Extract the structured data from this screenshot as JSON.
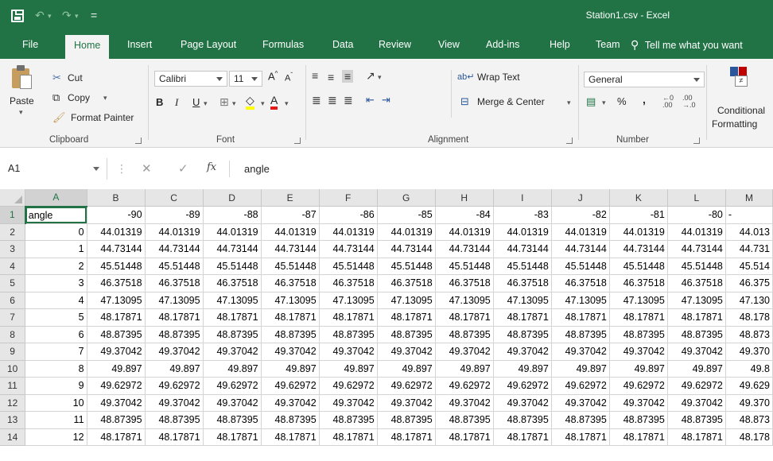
{
  "window": {
    "title": "Station1.csv  -  Excel"
  },
  "qat": {
    "undo": "↶",
    "undo_arrow": "▾",
    "redo": "↷",
    "redo_arrow": "▾",
    "customize": "="
  },
  "tabs": [
    "File",
    "Home",
    "Insert",
    "Page Layout",
    "Formulas",
    "Data",
    "Review",
    "View",
    "Add-ins",
    "Help",
    "Team"
  ],
  "active_tab": "Home",
  "tellme": "Tell me what you want",
  "clipboard": {
    "paste": "Paste",
    "cut": "Cut",
    "copy": "Copy",
    "format_painter": "Format Painter",
    "label": "Clipboard"
  },
  "font": {
    "name": "Calibri",
    "size": "11",
    "label": "Font",
    "bold": "B",
    "italic": "I",
    "underline": "U"
  },
  "alignment": {
    "wrap": "Wrap Text",
    "merge": "Merge & Center",
    "label": "Alignment"
  },
  "number": {
    "format": "General",
    "percent": "%",
    "comma": ",",
    "label": "Number"
  },
  "styles": {
    "conditional_line1": "Conditional",
    "conditional_line2": "Formatting"
  },
  "formula_bar": {
    "cell_ref": "A1",
    "fx": "fx",
    "value": "angle"
  },
  "grid": {
    "columns": [
      "A",
      "B",
      "C",
      "D",
      "E",
      "F",
      "G",
      "H",
      "I",
      "J",
      "K",
      "L",
      "M"
    ],
    "rows": [
      [
        "angle",
        "-90",
        "-89",
        "-88",
        "-87",
        "-86",
        "-85",
        "-84",
        "-83",
        "-82",
        "-81",
        "-80",
        "-"
      ],
      [
        "0",
        "44.01319",
        "44.01319",
        "44.01319",
        "44.01319",
        "44.01319",
        "44.01319",
        "44.01319",
        "44.01319",
        "44.01319",
        "44.01319",
        "44.01319",
        "44.013"
      ],
      [
        "1",
        "44.73144",
        "44.73144",
        "44.73144",
        "44.73144",
        "44.73144",
        "44.73144",
        "44.73144",
        "44.73144",
        "44.73144",
        "44.73144",
        "44.73144",
        "44.731"
      ],
      [
        "2",
        "45.51448",
        "45.51448",
        "45.51448",
        "45.51448",
        "45.51448",
        "45.51448",
        "45.51448",
        "45.51448",
        "45.51448",
        "45.51448",
        "45.51448",
        "45.514"
      ],
      [
        "3",
        "46.37518",
        "46.37518",
        "46.37518",
        "46.37518",
        "46.37518",
        "46.37518",
        "46.37518",
        "46.37518",
        "46.37518",
        "46.37518",
        "46.37518",
        "46.375"
      ],
      [
        "4",
        "47.13095",
        "47.13095",
        "47.13095",
        "47.13095",
        "47.13095",
        "47.13095",
        "47.13095",
        "47.13095",
        "47.13095",
        "47.13095",
        "47.13095",
        "47.130"
      ],
      [
        "5",
        "48.17871",
        "48.17871",
        "48.17871",
        "48.17871",
        "48.17871",
        "48.17871",
        "48.17871",
        "48.17871",
        "48.17871",
        "48.17871",
        "48.17871",
        "48.178"
      ],
      [
        "6",
        "48.87395",
        "48.87395",
        "48.87395",
        "48.87395",
        "48.87395",
        "48.87395",
        "48.87395",
        "48.87395",
        "48.87395",
        "48.87395",
        "48.87395",
        "48.873"
      ],
      [
        "7",
        "49.37042",
        "49.37042",
        "49.37042",
        "49.37042",
        "49.37042",
        "49.37042",
        "49.37042",
        "49.37042",
        "49.37042",
        "49.37042",
        "49.37042",
        "49.370"
      ],
      [
        "8",
        "49.897",
        "49.897",
        "49.897",
        "49.897",
        "49.897",
        "49.897",
        "49.897",
        "49.897",
        "49.897",
        "49.897",
        "49.897",
        "49.8"
      ],
      [
        "9",
        "49.62972",
        "49.62972",
        "49.62972",
        "49.62972",
        "49.62972",
        "49.62972",
        "49.62972",
        "49.62972",
        "49.62972",
        "49.62972",
        "49.62972",
        "49.629"
      ],
      [
        "10",
        "49.37042",
        "49.37042",
        "49.37042",
        "49.37042",
        "49.37042",
        "49.37042",
        "49.37042",
        "49.37042",
        "49.37042",
        "49.37042",
        "49.37042",
        "49.370"
      ],
      [
        "11",
        "48.87395",
        "48.87395",
        "48.87395",
        "48.87395",
        "48.87395",
        "48.87395",
        "48.87395",
        "48.87395",
        "48.87395",
        "48.87395",
        "48.87395",
        "48.873"
      ],
      [
        "12",
        "48.17871",
        "48.17871",
        "48.17871",
        "48.17871",
        "48.17871",
        "48.17871",
        "48.17871",
        "48.17871",
        "48.17871",
        "48.17871",
        "48.17871",
        "48.178"
      ]
    ]
  },
  "colors": {
    "excel_green": "#217346",
    "ribbon_bg": "#f3f3f3",
    "header_bg": "#e6e6e6",
    "gridline": "#d4d4d4"
  }
}
